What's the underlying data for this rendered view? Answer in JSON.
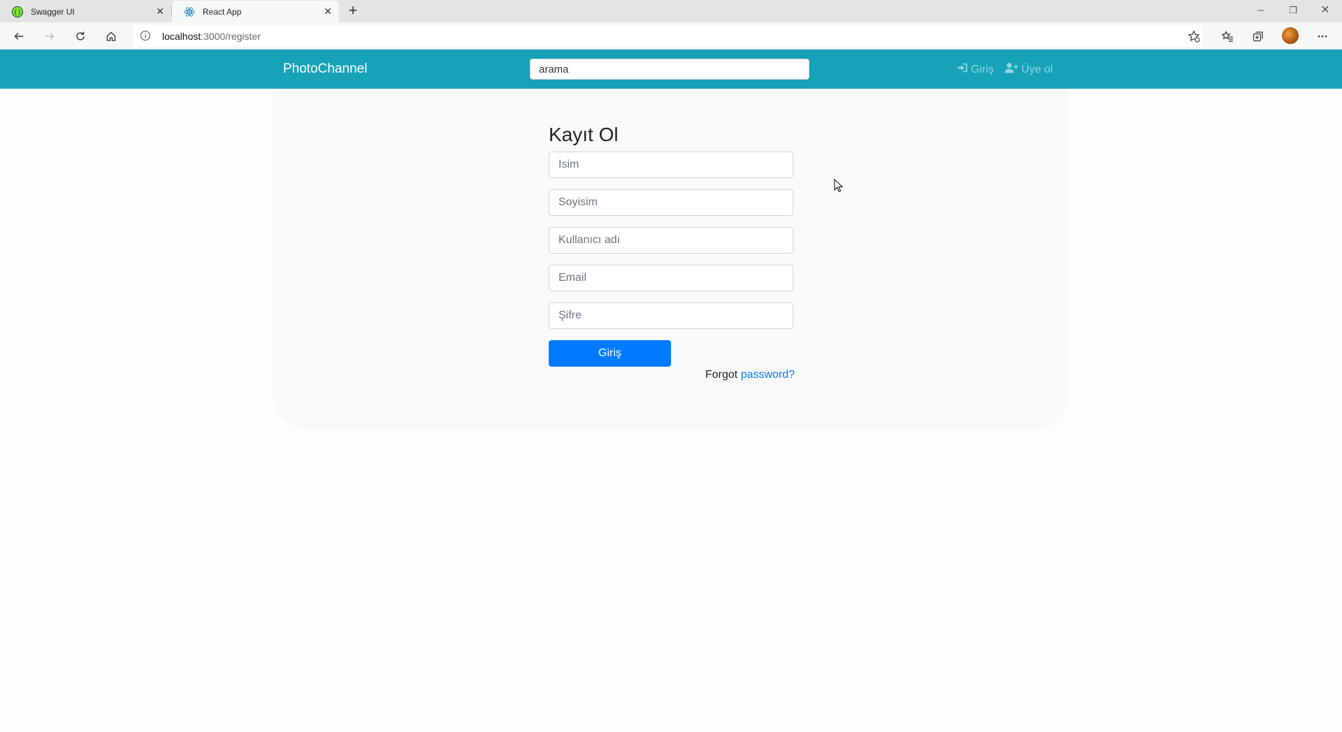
{
  "browser": {
    "tabs": [
      {
        "title": "Swagger UI",
        "active": false,
        "icon": "swagger-icon"
      },
      {
        "title": "React App",
        "active": true,
        "icon": "react-icon"
      }
    ],
    "url_host": "localhost",
    "url_path": ":3000/register"
  },
  "navbar": {
    "brand": "PhotoChannel",
    "search_value": "arama",
    "login_label": "Giriş",
    "register_label": "Üye ol",
    "bg_color": "#17a2b8"
  },
  "form": {
    "title": "Kayıt Ol",
    "first_name_placeholder": "İsim",
    "last_name_placeholder": "Soyisim",
    "username_placeholder": "Kullanıcı adı",
    "email_placeholder": "Email",
    "password_placeholder": "Şifre",
    "submit_label": "Giriş",
    "forgot_text": "Forgot",
    "forgot_link": "password?",
    "accent_color": "#007bff"
  }
}
